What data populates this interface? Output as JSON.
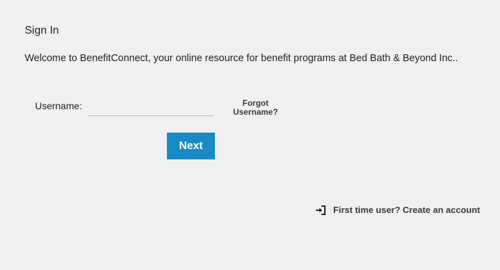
{
  "signin": {
    "title": "Sign In",
    "welcome": "Welcome to BenefitConnect, your online resource for benefit programs at Bed Bath & Beyond Inc..",
    "username_label": "Username:",
    "username_value": "",
    "forgot_line1": "Forgot",
    "forgot_line2": "Username?",
    "next_label": "Next"
  },
  "footer": {
    "create_account_icon": "sign-in-arrow-icon",
    "create_account_label": "First time user? Create an account"
  },
  "colors": {
    "background": "#f0f0f0",
    "primary_button": "#1a8ac6",
    "input_underline": "#b5b5b5",
    "link_text": "#3a3a3a"
  }
}
